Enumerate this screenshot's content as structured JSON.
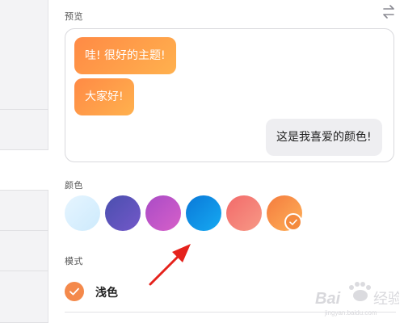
{
  "sections": {
    "preview_label": "预览",
    "color_label": "颜色",
    "mode_label": "模式"
  },
  "preview": {
    "bubbles": [
      {
        "text": "哇! 很好的主题!",
        "side": "left"
      },
      {
        "text": "大家好!",
        "side": "left"
      },
      {
        "text": "这是我喜爱的颜色!",
        "side": "right"
      }
    ]
  },
  "colors": {
    "swatches": [
      {
        "name": "light-blue",
        "from": "#e6f5ff",
        "to": "#cdeafc"
      },
      {
        "name": "indigo",
        "from": "#4a4fae",
        "to": "#7358c9"
      },
      {
        "name": "purple",
        "from": "#a94bc6",
        "to": "#d760c9"
      },
      {
        "name": "blue",
        "from": "#0a78d8",
        "to": "#16aaf2"
      },
      {
        "name": "coral",
        "from": "#f26a6a",
        "to": "#f79986"
      },
      {
        "name": "orange",
        "from": "#f47b3e",
        "to": "#ffb259"
      }
    ],
    "selected": "orange",
    "accent": "#f4894b"
  },
  "mode": {
    "current": "浅色"
  },
  "icons": {
    "swap": "swap-arrows-icon",
    "check": "check-icon"
  },
  "watermark": {
    "text": "Baidu经验"
  }
}
